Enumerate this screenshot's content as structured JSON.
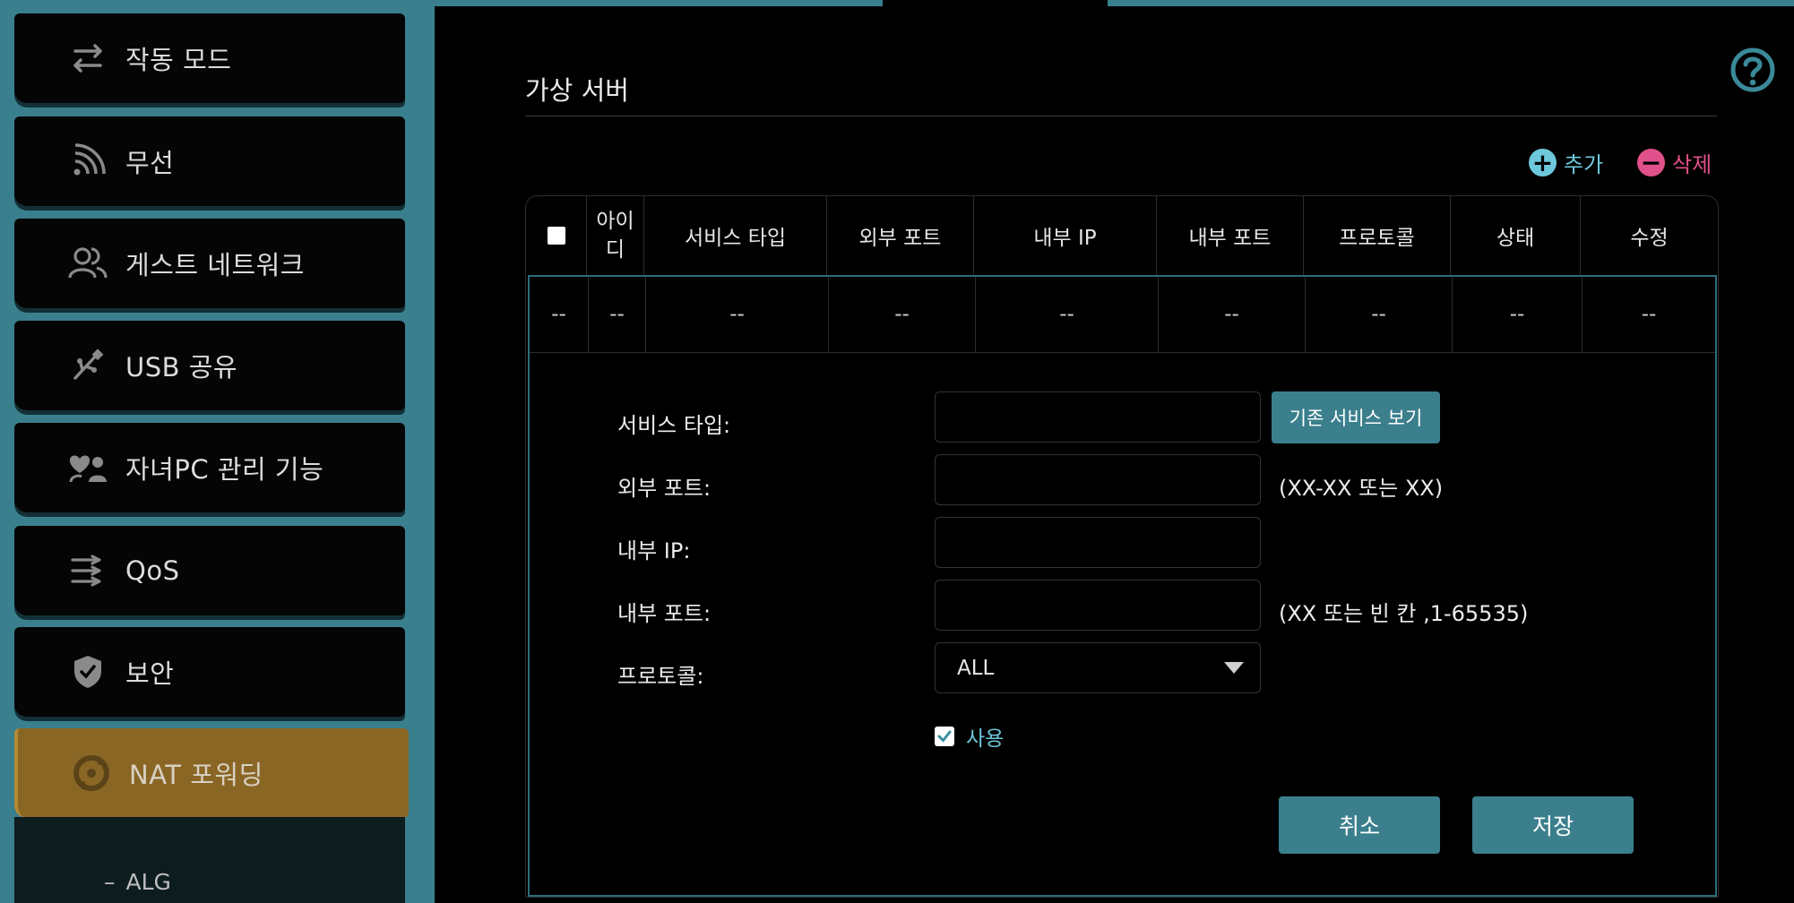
{
  "sidebar": {
    "items": [
      {
        "label": "작동 모드",
        "icon": "switch-mode-icon"
      },
      {
        "label": "무선",
        "icon": "wireless-icon"
      },
      {
        "label": "게스트 네트워크",
        "icon": "guest-network-icon"
      },
      {
        "label": "USB 공유",
        "icon": "usb-icon"
      },
      {
        "label": "자녀PC 관리 기능",
        "icon": "parental-control-icon"
      },
      {
        "label": "QoS",
        "icon": "qos-icon"
      },
      {
        "label": "보안",
        "icon": "shield-icon"
      },
      {
        "label": "NAT 포워딩",
        "icon": "nat-forwarding-icon",
        "active": true
      }
    ],
    "sub_items": [
      {
        "dash": "–",
        "label": "ALG"
      }
    ]
  },
  "main": {
    "title": "가상 서버",
    "add_label": "추가",
    "delete_label": "삭제",
    "table": {
      "headers": [
        "",
        "아이디",
        "서비스 타입",
        "외부 포트",
        "내부 IP",
        "내부 포트",
        "프로토콜",
        "상태",
        "수정"
      ],
      "row": [
        "--",
        "--",
        "--",
        "--",
        "--",
        "--",
        "--",
        "--",
        "--"
      ]
    },
    "form": {
      "service_type_label": "서비스 타입:",
      "service_type_value": "",
      "view_services_button": "기존 서비스 보기",
      "external_port_label": "외부 포트:",
      "external_port_value": "",
      "external_port_hint": "(XX-XX 또는 XX)",
      "internal_ip_label": "내부 IP:",
      "internal_ip_value": "",
      "internal_port_label": "내부 포트:",
      "internal_port_value": "",
      "internal_port_hint": "(XX 또는 빈 칸 ,1-65535)",
      "protocol_label": "프로토콜:",
      "protocol_value": "ALL",
      "enable_label": "사용",
      "enable_checked": true,
      "cancel_button": "취소",
      "save_button": "저장"
    }
  },
  "colors": {
    "accent_teal": "#3a7f8e",
    "active_nav": "#8a6625",
    "add_color": "#6ec8dc",
    "delete_color": "#e0508a"
  }
}
